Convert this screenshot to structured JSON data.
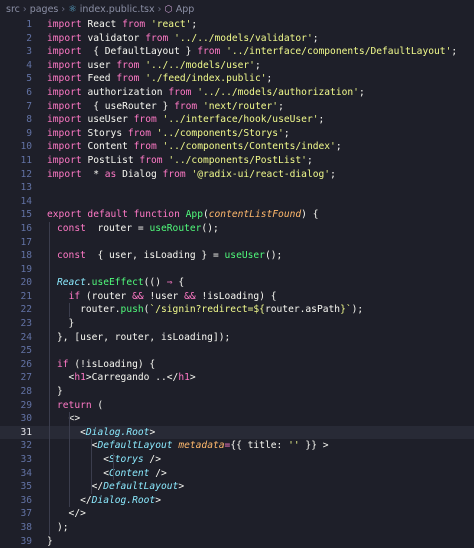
{
  "breadcrumb": {
    "parts": [
      "src",
      "pages",
      "index.public.tsx",
      "App"
    ],
    "file_icon": "tsx-file-icon",
    "symbol_icon": "function-symbol-icon"
  },
  "editor": {
    "current_line": 31,
    "lines": [
      {
        "n": "1",
        "t": [
          [
            "k",
            "import"
          ],
          [
            "",
            "React "
          ],
          [
            "k",
            "from"
          ],
          [
            "",
            " "
          ],
          [
            "s",
            "'react'"
          ],
          [
            "",
            ";"
          ]
        ]
      },
      {
        "n": "2",
        "t": [
          [
            "k",
            "import"
          ],
          [
            "",
            "validator "
          ],
          [
            "k",
            "from"
          ],
          [
            "",
            " "
          ],
          [
            "s",
            "'../../models/validator'"
          ],
          [
            "",
            ";"
          ]
        ]
      },
      {
        "n": "3",
        "t": [
          [
            "k",
            "import"
          ],
          [
            "",
            " { DefaultLayout } "
          ],
          [
            "k",
            "from"
          ],
          [
            "",
            " "
          ],
          [
            "s",
            "'../interface/components/DefaultLayout'"
          ],
          [
            "",
            ";"
          ]
        ]
      },
      {
        "n": "4",
        "t": [
          [
            "k",
            "import"
          ],
          [
            "",
            "user "
          ],
          [
            "k",
            "from"
          ],
          [
            "",
            " "
          ],
          [
            "s",
            "'../../models/user'"
          ],
          [
            "",
            ";"
          ]
        ]
      },
      {
        "n": "5",
        "t": [
          [
            "k",
            "import"
          ],
          [
            "",
            "Feed "
          ],
          [
            "k",
            "from"
          ],
          [
            "",
            " "
          ],
          [
            "s",
            "'./feed/index.public'"
          ],
          [
            "",
            ";"
          ]
        ]
      },
      {
        "n": "6",
        "t": [
          [
            "k",
            "import"
          ],
          [
            "",
            "authorization "
          ],
          [
            "k",
            "from"
          ],
          [
            "",
            " "
          ],
          [
            "s",
            "'../../models/authorization'"
          ],
          [
            "",
            ";"
          ]
        ]
      },
      {
        "n": "7",
        "t": [
          [
            "k",
            "import"
          ],
          [
            "",
            " { useRouter } "
          ],
          [
            "k",
            "from"
          ],
          [
            "",
            " "
          ],
          [
            "s",
            "'next/router'"
          ],
          [
            "",
            ";"
          ]
        ]
      },
      {
        "n": "8",
        "t": [
          [
            "k",
            "import"
          ],
          [
            "",
            "useUser "
          ],
          [
            "k",
            "from"
          ],
          [
            "",
            " "
          ],
          [
            "s",
            "'../interface/hook/useUser'"
          ],
          [
            "",
            ";"
          ]
        ]
      },
      {
        "n": "9",
        "t": [
          [
            "k",
            "import"
          ],
          [
            "",
            "Storys "
          ],
          [
            "k",
            "from"
          ],
          [
            "",
            " "
          ],
          [
            "s",
            "'../components/Storys'"
          ],
          [
            "",
            ";"
          ]
        ]
      },
      {
        "n": "10",
        "t": [
          [
            "k",
            "import"
          ],
          [
            "",
            "Content "
          ],
          [
            "k",
            "from"
          ],
          [
            "",
            " "
          ],
          [
            "s",
            "'../components/Contents/index'"
          ],
          [
            "",
            ";"
          ]
        ]
      },
      {
        "n": "11",
        "t": [
          [
            "k",
            "import"
          ],
          [
            "",
            "PostList "
          ],
          [
            "k",
            "from"
          ],
          [
            "",
            " "
          ],
          [
            "s",
            "'../components/PostList'"
          ],
          [
            "",
            ";"
          ]
        ]
      },
      {
        "n": "12",
        "t": [
          [
            "k",
            "import"
          ],
          [
            "",
            " * "
          ],
          [
            "k",
            "as"
          ],
          [
            "",
            " Dialog "
          ],
          [
            "k",
            "from"
          ],
          [
            "",
            " "
          ],
          [
            "s",
            "'@radix-ui/react-dialog'"
          ],
          [
            "",
            ";"
          ]
        ]
      },
      {
        "n": "13",
        "t": []
      },
      {
        "n": "14",
        "t": []
      },
      {
        "n": "15",
        "t": [
          [
            "k",
            "export default function"
          ],
          [
            "",
            " "
          ],
          [
            "f",
            "App"
          ],
          [
            "",
            "("
          ],
          [
            "p",
            "contentListFound"
          ],
          [
            "",
            ") {"
          ]
        ]
      },
      {
        "n": "16",
        "t": [
          [
            "",
            ""
          ],
          [
            "k",
            "const"
          ],
          [
            "",
            "  router = "
          ],
          [
            "f",
            "useRouter"
          ],
          [
            "",
            "();"
          ]
        ]
      },
      {
        "n": "17",
        "t": []
      },
      {
        "n": "18",
        "t": [
          [
            "k",
            "const"
          ],
          [
            "",
            "  { user, isLoading } = "
          ],
          [
            "f",
            "useUser"
          ],
          [
            "",
            "();"
          ]
        ]
      },
      {
        "n": "19",
        "t": []
      },
      {
        "n": "20",
        "t": [
          [
            "i",
            "React"
          ],
          [
            "",
            "."
          ],
          [
            "f",
            "useEffect"
          ],
          [
            "",
            "(() "
          ],
          [
            "k",
            "⇒"
          ],
          [
            "",
            " {"
          ]
        ]
      },
      {
        "n": "21",
        "t": [
          [
            "",
            "  "
          ],
          [
            "k",
            "if"
          ],
          [
            "",
            " (router "
          ],
          [
            "k",
            "&&"
          ],
          [
            "",
            " !user "
          ],
          [
            "k",
            "&&"
          ],
          [
            "",
            " !isLoading) {"
          ]
        ]
      },
      {
        "n": "22",
        "t": [
          [
            "",
            "    router."
          ],
          [
            "f",
            "push"
          ],
          [
            "",
            "("
          ],
          [
            "s",
            "`/signin?redirect=${"
          ],
          [
            "",
            "router.asPath"
          ],
          [
            "s",
            "}`"
          ],
          [
            "",
            ");"
          ]
        ]
      },
      {
        "n": "23",
        "t": [
          [
            "",
            "  }"
          ]
        ]
      },
      {
        "n": "24",
        "t": [
          [
            "",
            "}, [user, router, isLoading]);"
          ]
        ]
      },
      {
        "n": "25",
        "t": []
      },
      {
        "n": "26",
        "t": [
          [
            "k",
            "if"
          ],
          [
            "",
            " (!isLoading) {"
          ]
        ]
      },
      {
        "n": "27",
        "t": [
          [
            "",
            "  <"
          ],
          [
            "t",
            "h1"
          ],
          [
            "",
            ">Carregando ..</"
          ],
          [
            "t",
            "h1"
          ],
          [
            "",
            ">"
          ]
        ]
      },
      {
        "n": "28",
        "t": [
          [
            "",
            "}"
          ]
        ]
      },
      {
        "n": "29",
        "t": [
          [
            "k",
            "return"
          ],
          [
            "",
            " ("
          ]
        ]
      },
      {
        "n": "30",
        "t": [
          [
            "",
            "  <>"
          ]
        ]
      },
      {
        "n": "31",
        "t": [
          [
            "",
            "    <"
          ],
          [
            "i",
            "Dialog.Root"
          ],
          [
            "",
            ">"
          ]
        ]
      },
      {
        "n": "32",
        "t": [
          [
            "",
            "      <"
          ],
          [
            "i",
            "DefaultLayout"
          ],
          [
            "",
            " "
          ],
          [
            "p",
            "metadata"
          ],
          [
            "k",
            "="
          ],
          [
            "",
            "{{ title: "
          ],
          [
            "s",
            "''"
          ],
          [
            "",
            " }} >"
          ]
        ]
      },
      {
        "n": "33",
        "t": [
          [
            "",
            "        <"
          ],
          [
            "i",
            "Storys"
          ],
          [
            "",
            " />"
          ]
        ]
      },
      {
        "n": "34",
        "t": [
          [
            "",
            "        <"
          ],
          [
            "i",
            "Content"
          ],
          [
            "",
            " />"
          ]
        ]
      },
      {
        "n": "35",
        "t": [
          [
            "",
            "      </"
          ],
          [
            "i",
            "DefaultLayout"
          ],
          [
            "",
            ">"
          ]
        ]
      },
      {
        "n": "36",
        "t": [
          [
            "",
            "    </"
          ],
          [
            "i",
            "Dialog.Root"
          ],
          [
            "",
            ">"
          ]
        ]
      },
      {
        "n": "37",
        "t": [
          [
            "",
            "  </>"
          ]
        ]
      },
      {
        "n": "38",
        "t": [
          [
            "",
            ");"
          ]
        ]
      },
      {
        "n": "39",
        "t": [
          [
            "",
            "}"
          ]
        ]
      }
    ]
  }
}
